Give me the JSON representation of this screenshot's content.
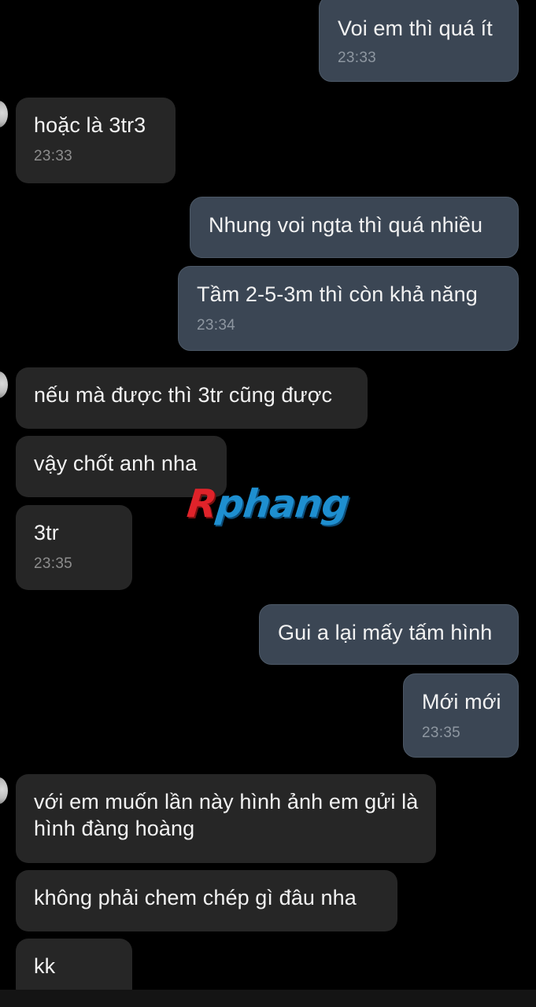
{
  "messages": [
    {
      "text": "Voi em thì quá ít",
      "time": "23:33"
    },
    {
      "text": "hoặc là 3tr3",
      "time": "23:33"
    },
    {
      "text": "Nhung voi ngta thì quá nhiều"
    },
    {
      "text": "Tầm 2-5-3m thì còn khả năng",
      "time": "23:34"
    },
    {
      "text": "nếu mà được thì 3tr cũng được"
    },
    {
      "text": "vậy chốt anh nha"
    },
    {
      "text": "3tr",
      "time": "23:35"
    },
    {
      "text": "Gui a lại mấy tấm hình"
    },
    {
      "text": "Mới mới",
      "time": "23:35"
    },
    {
      "text": "với em muốn lần này hình ảnh em gửi là hình đàng hoàng"
    },
    {
      "text": "không phải chem chép gì đâu nha"
    },
    {
      "text": "kk"
    }
  ],
  "watermark": {
    "first_letter": "R",
    "rest": "phang"
  },
  "colors": {
    "background": "#000000",
    "incoming_bubble": "#262626",
    "outgoing_bubble": "#3b4654"
  }
}
